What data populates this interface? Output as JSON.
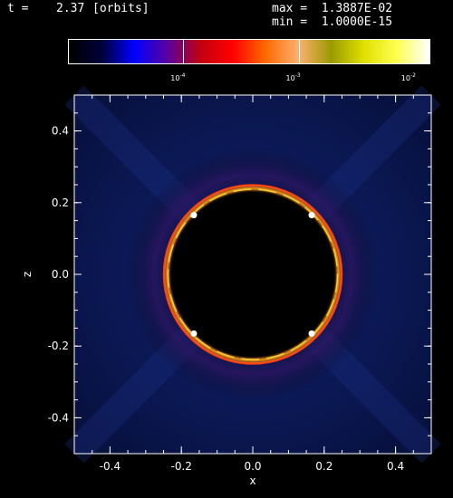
{
  "header": {
    "t_label": "t =",
    "t_value": "2.37",
    "t_unit": "[orbits]",
    "max_text": "max =  1.3887E-02",
    "min_text": "min =  1.0000E-15"
  },
  "colorbar": {
    "ticks": [
      {
        "base": "10",
        "exp": "-4",
        "value": 0.0001
      },
      {
        "base": "10",
        "exp": "-3",
        "value": 0.001
      },
      {
        "base": "10",
        "exp": "-2",
        "value": 0.01
      }
    ],
    "stops": [
      "#000000",
      "#00003a",
      "#0000ff",
      "#5a00a0",
      "#c00010",
      "#ff0000",
      "#ff6a00",
      "#ffb070",
      "#9a9a00",
      "#e0e000",
      "#ffff50",
      "#ffffff"
    ],
    "log_range": [
      -5,
      -1.857
    ]
  },
  "chart_data": {
    "type": "heatmap",
    "xlabel": "x",
    "ylabel": "z",
    "xlim": [
      -0.5,
      0.5
    ],
    "ylim": [
      -0.5,
      0.5
    ],
    "xticks": [
      "-0.4",
      "-0.2",
      "0.0",
      "0.2",
      "0.4"
    ],
    "xtick_values": [
      -0.4,
      -0.2,
      0.0,
      0.2,
      0.4
    ],
    "yticks": [
      "0.4",
      "0.2",
      "0.0",
      "-0.2",
      "-0.4"
    ],
    "ytick_values": [
      0.4,
      0.2,
      0.0,
      -0.2,
      -0.4
    ],
    "ring": {
      "center_x": 0.0,
      "center_z": 0.0,
      "radius": 0.245,
      "color": "#ff9a20"
    },
    "bright_spots": [
      {
        "x": -0.165,
        "z": 0.165
      },
      {
        "x": 0.165,
        "z": 0.165
      },
      {
        "x": -0.165,
        "z": -0.165
      },
      {
        "x": 0.165,
        "z": -0.165
      }
    ],
    "background_color": "#06103a",
    "interior_color": "#000000"
  }
}
